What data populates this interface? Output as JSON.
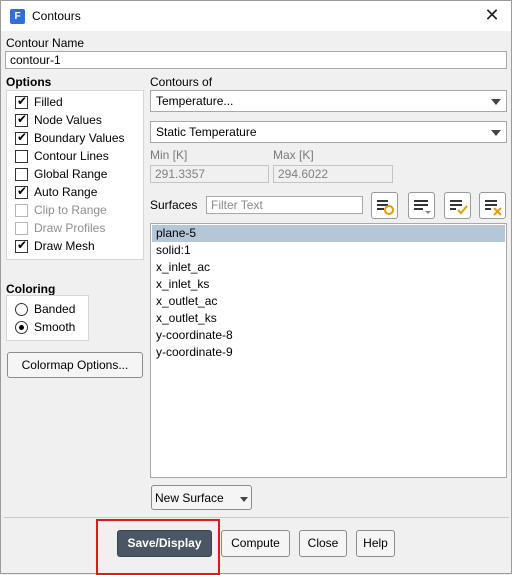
{
  "window": {
    "title": "Contours",
    "app_icon_letter": "F"
  },
  "contour_name": {
    "label": "Contour Name",
    "value": "contour-1"
  },
  "options": {
    "label": "Options",
    "items": [
      {
        "label": "Filled",
        "checked": true,
        "enabled": true
      },
      {
        "label": "Node Values",
        "checked": true,
        "enabled": true
      },
      {
        "label": "Boundary Values",
        "checked": true,
        "enabled": true
      },
      {
        "label": "Contour Lines",
        "checked": false,
        "enabled": true
      },
      {
        "label": "Global Range",
        "checked": false,
        "enabled": true
      },
      {
        "label": "Auto Range",
        "checked": true,
        "enabled": true
      },
      {
        "label": "Clip to Range",
        "checked": false,
        "enabled": false
      },
      {
        "label": "Draw Profiles",
        "checked": false,
        "enabled": false
      },
      {
        "label": "Draw Mesh",
        "checked": true,
        "enabled": true
      }
    ]
  },
  "coloring": {
    "label": "Coloring",
    "items": [
      {
        "label": "Banded",
        "selected": false
      },
      {
        "label": "Smooth",
        "selected": true
      }
    ]
  },
  "colormap_button": "Colormap Options...",
  "contours_of": {
    "label": "Contours of",
    "category": "Temperature...",
    "variable": "Static Temperature"
  },
  "range": {
    "min_label": "Min [K]",
    "min_value": "291.3357",
    "max_label": "Max [K]",
    "max_value": "294.6022"
  },
  "surfaces": {
    "label": "Surfaces",
    "filter_placeholder": "Filter Text",
    "items": [
      "plane-5",
      "solid:1",
      "x_inlet_ac",
      "x_inlet_ks",
      "x_outlet_ac",
      "x_outlet_ks",
      "y-coordinate-8",
      "y-coordinate-9"
    ],
    "selected_index": 0
  },
  "new_surface_button": "New Surface",
  "footer": {
    "save_display": "Save/Display",
    "compute": "Compute",
    "close": "Close",
    "help": "Help"
  },
  "colors": {
    "selection": "#b5c6d9",
    "primary_button": "#4a5663",
    "highlight": "#e0171b"
  }
}
